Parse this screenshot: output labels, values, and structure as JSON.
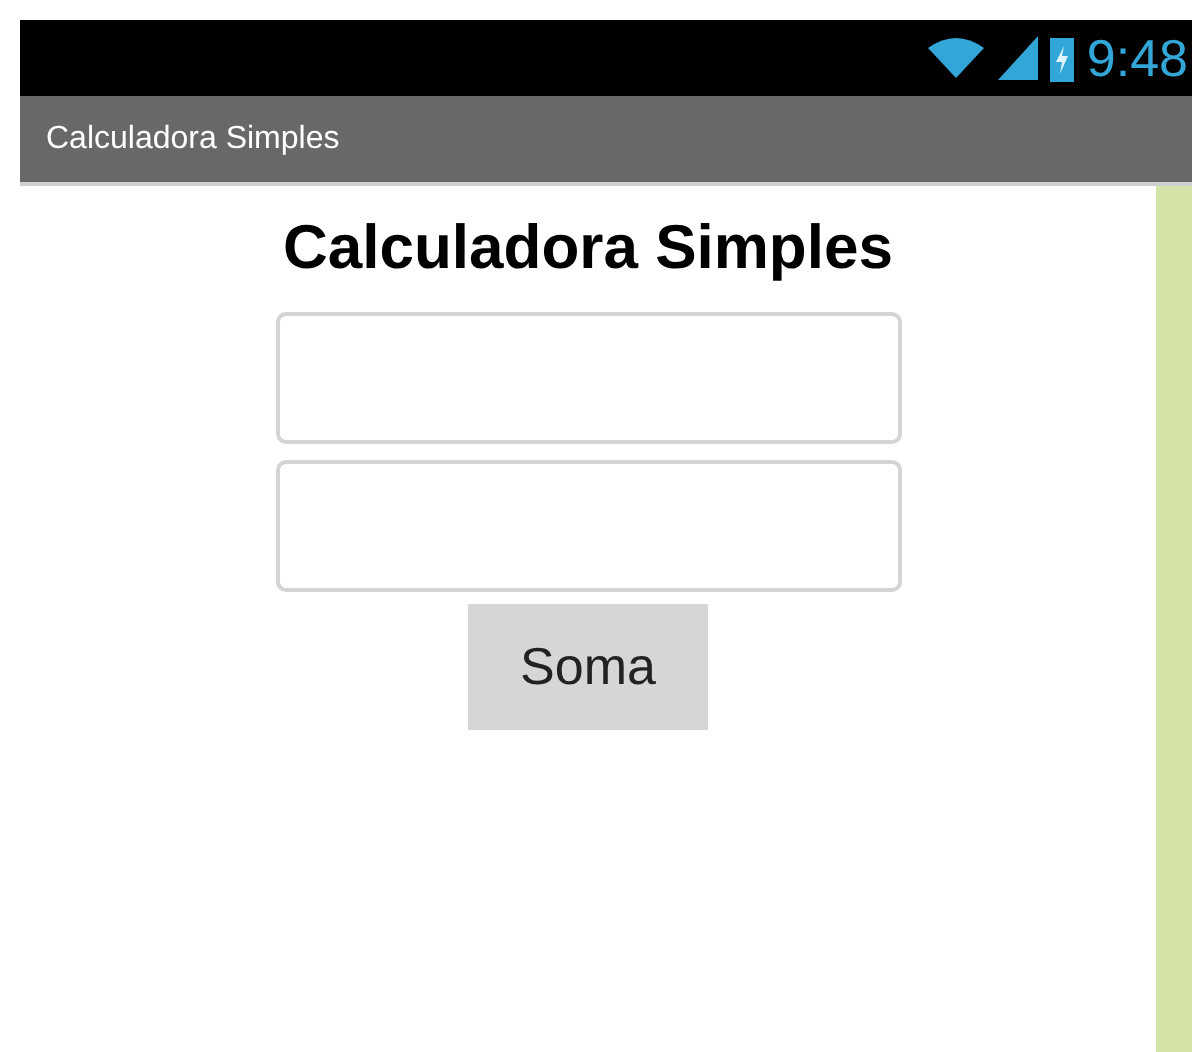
{
  "status_bar": {
    "time": "9:48"
  },
  "title_bar": {
    "title": "Calculadora Simples"
  },
  "heading": "Calculadora Simples",
  "fields": [
    {
      "kind": "text"
    },
    {
      "kind": "text"
    }
  ],
  "button": {
    "label": "Soma"
  }
}
